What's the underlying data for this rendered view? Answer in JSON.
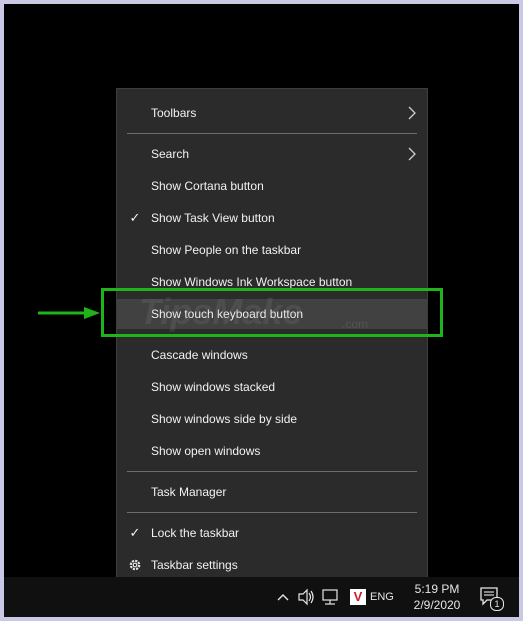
{
  "context_menu": {
    "items": [
      {
        "label": "Toolbars",
        "submenu": true,
        "checked": false
      },
      {
        "label": "Search",
        "submenu": true,
        "checked": false
      },
      {
        "label": "Show Cortana button",
        "submenu": false,
        "checked": false
      },
      {
        "label": "Show Task View button",
        "submenu": false,
        "checked": true
      },
      {
        "label": "Show People on the taskbar",
        "submenu": false,
        "checked": false
      },
      {
        "label": "Show Windows Ink Workspace button",
        "submenu": false,
        "checked": false
      },
      {
        "label": "Show touch keyboard button",
        "submenu": false,
        "checked": false,
        "highlighted": true
      },
      {
        "label": "Cascade windows",
        "submenu": false,
        "checked": false
      },
      {
        "label": "Show windows stacked",
        "submenu": false,
        "checked": false
      },
      {
        "label": "Show windows side by side",
        "submenu": false,
        "checked": false
      },
      {
        "label": "Show open windows",
        "submenu": false,
        "checked": false
      },
      {
        "label": "Task Manager",
        "submenu": false,
        "checked": false
      },
      {
        "label": "Lock the taskbar",
        "submenu": false,
        "checked": true
      },
      {
        "label": "Taskbar settings",
        "submenu": false,
        "checked": false,
        "icon": "gear-icon"
      }
    ],
    "check_glyph": "✓"
  },
  "watermark": {
    "text": "TipsMake",
    "suffix": ".com"
  },
  "taskbar": {
    "time": "5:19 PM",
    "date": "2/9/2020",
    "language": "ENG",
    "antivirus_badge": "V",
    "notification_count": "1",
    "icons": [
      "chevron-up-icon",
      "volume-icon",
      "network-icon",
      "antivirus-icon",
      "notification-icon"
    ]
  },
  "colors": {
    "menu_bg": "#2b2b2b",
    "menu_text": "#f2f2f2",
    "highlight": "#1fb51a",
    "taskbar_bg": "#101010",
    "frame": "#c9c9e6"
  }
}
